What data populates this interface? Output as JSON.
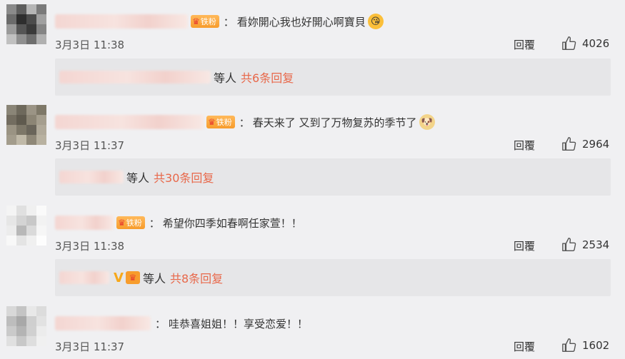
{
  "comments": [
    {
      "badge": "铁粉",
      "colon": "：",
      "text": "看妳開心我也好開心啊寶貝",
      "time": "3月3日 11:38",
      "reply": "回覆",
      "likes": "4026",
      "thread": {
        "label": "等人",
        "count": "共6条回复"
      }
    },
    {
      "badge": "铁粉",
      "colon": "：",
      "text": "春天来了 又到了万物复苏的季节了",
      "time": "3月3日 11:37",
      "reply": "回覆",
      "likes": "2964",
      "thread": {
        "label": "等人",
        "count": "共30条回复"
      }
    },
    {
      "badge": "铁粉",
      "colon": "：",
      "text": "希望你四季如春啊任家萱！！",
      "time": "3月3日 11:38",
      "reply": "回覆",
      "likes": "2534",
      "thread": {
        "label": "等人",
        "count": "共8条回复"
      }
    },
    {
      "colon": "：",
      "text": "哇恭喜姐姐！！享受恋爱！！",
      "time": "3月3日 11:37",
      "reply": "回覆",
      "likes": "1602"
    }
  ],
  "colors": {
    "link": "#e8684a",
    "badge": "#f79c2c",
    "background": "#f0f0f2",
    "thread_bg": "#e6e6e8"
  },
  "icons": {
    "like": "thumbs-up-icon",
    "crown": "crown-icon",
    "vip": "vip-v-icon"
  }
}
